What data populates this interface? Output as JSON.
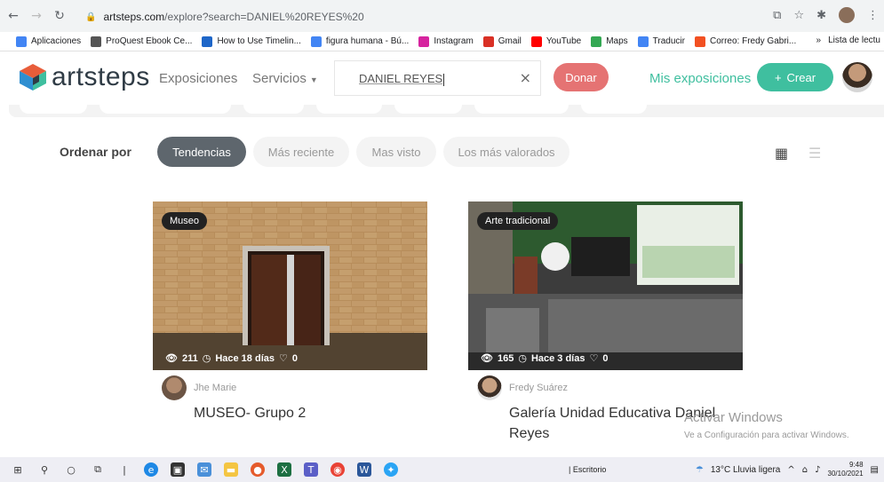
{
  "browser": {
    "url_host": "artsteps.com",
    "url_path": "/explore?search=DANIEL%20REYES%20",
    "bookmarks": [
      {
        "label": "Aplicaciones",
        "icon": "apps-grid-icon",
        "color": "#4285f4"
      },
      {
        "label": "ProQuest Ebook Ce...",
        "icon": "globe-icon",
        "color": "#555555"
      },
      {
        "label": "How to Use Timelin...",
        "icon": "v-logo-icon",
        "color": "#1e66c8"
      },
      {
        "label": "figura humana - Bú...",
        "icon": "google-g-icon",
        "color": "#4285f4"
      },
      {
        "label": "Instagram",
        "icon": "instagram-icon",
        "color": "#d6249f"
      },
      {
        "label": "Gmail",
        "icon": "gmail-icon",
        "color": "#d93025"
      },
      {
        "label": "YouTube",
        "icon": "youtube-icon",
        "color": "#ff0000"
      },
      {
        "label": "Maps",
        "icon": "maps-pin-icon",
        "color": "#34a853"
      },
      {
        "label": "Traducir",
        "icon": "translate-icon",
        "color": "#4285f4"
      },
      {
        "label": "Correo: Fredy Gabri...",
        "icon": "outlook-icon",
        "color": "#f25022"
      }
    ],
    "bookmarks_overflow": "»",
    "reading_list": "Lista de lectu"
  },
  "header": {
    "logo_text": "artsteps",
    "nav_exhibitions": "Exposiciones",
    "nav_services": "Servicios",
    "search_value": "DANIEL REYES",
    "donate_label": "Donar",
    "my_exhibitions": "Mis exposiciones",
    "create_label": "Crear",
    "accent_color": "#3fbf9f",
    "donate_color": "#e57373"
  },
  "sort": {
    "label": "Ordenar por",
    "options": [
      "Tendencias",
      "Más reciente",
      "Mas visto",
      "Los más valorados"
    ],
    "active": "Tendencias"
  },
  "cards": [
    {
      "tag": "Museo",
      "views": "211",
      "time": "Hace 18 días",
      "likes": "0",
      "author": "Jhe Marie",
      "title": "MUSEO- Grupo 2"
    },
    {
      "tag": "Arte tradicional",
      "views": "165",
      "time": "Hace 3 días",
      "likes": "0",
      "author": "Fredy Suárez",
      "title": "Galería Unidad Educativa Daniel Reyes"
    }
  ],
  "watermark": {
    "title": "Activar Windows",
    "subtitle": "Ve a Configuración para activar Windows."
  },
  "taskbar": {
    "escritorio": "Escritorio",
    "weather": "13°C  Lluvia ligera",
    "time": "9:48",
    "date": "30/10/2021"
  }
}
